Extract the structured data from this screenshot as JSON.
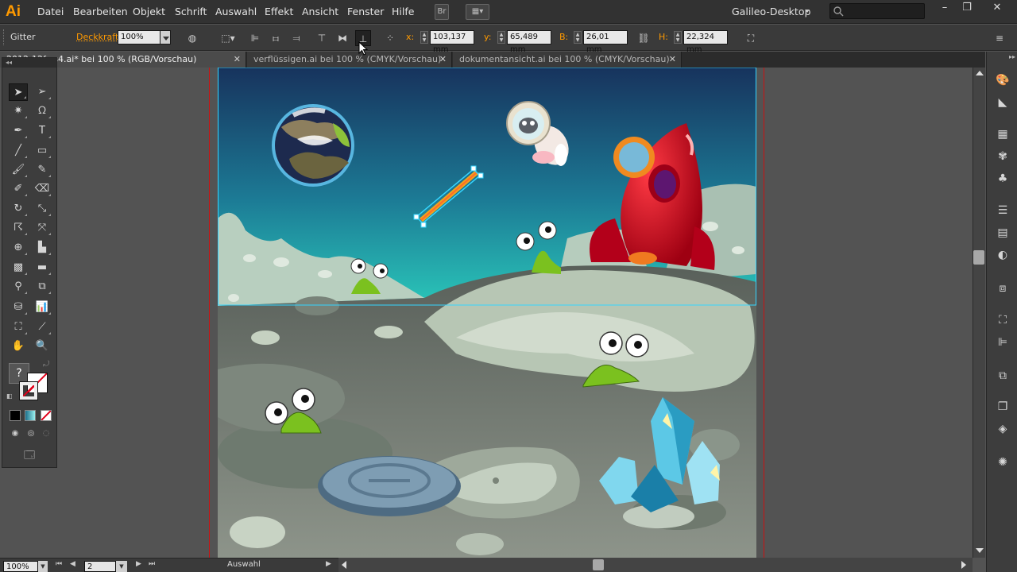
{
  "app": {
    "logo": "Ai",
    "workspace": "Galileo-Desktop",
    "brand_color": "#ff9a00"
  },
  "menu": {
    "items": [
      "Datei",
      "Bearbeiten",
      "Objekt",
      "Schrift",
      "Auswahl",
      "Effekt",
      "Ansicht",
      "Fenster",
      "Hilfe"
    ],
    "bridge_button": "Br"
  },
  "control": {
    "selection_label": "Gitter",
    "opacity_label": "Deckkraft:",
    "opacity_value": "100%",
    "x_label": "x:",
    "x_value": "103,137 mm",
    "y_label": "y:",
    "y_value": "65,489 mm",
    "w_label": "B:",
    "w_value": "26,01 mm",
    "h_label": "H:",
    "h_value": "22,324 mm"
  },
  "tabs": [
    {
      "label": "2012-12f-cs4.ai* bei 100 % (RGB/Vorschau)",
      "active": true
    },
    {
      "label": "verflüssigen.ai bei 100 % (CMYK/Vorschau)",
      "active": false
    },
    {
      "label": "dokumentansicht.ai bei 100 % (CMYK/Vorschau)",
      "active": false
    }
  ],
  "tools_panel": {
    "header": "◂◂",
    "help": "?"
  },
  "status": {
    "zoom": "100%",
    "artboard": "2",
    "tool_text": "Auswahl"
  },
  "colors": {
    "sky_top": "#17335d",
    "sky_bottom": "#2ac6b9",
    "rocket": "#c8001b",
    "slime": "#7bc11f",
    "crystal": "#5cc8e6",
    "selection": "#35d5ff"
  }
}
